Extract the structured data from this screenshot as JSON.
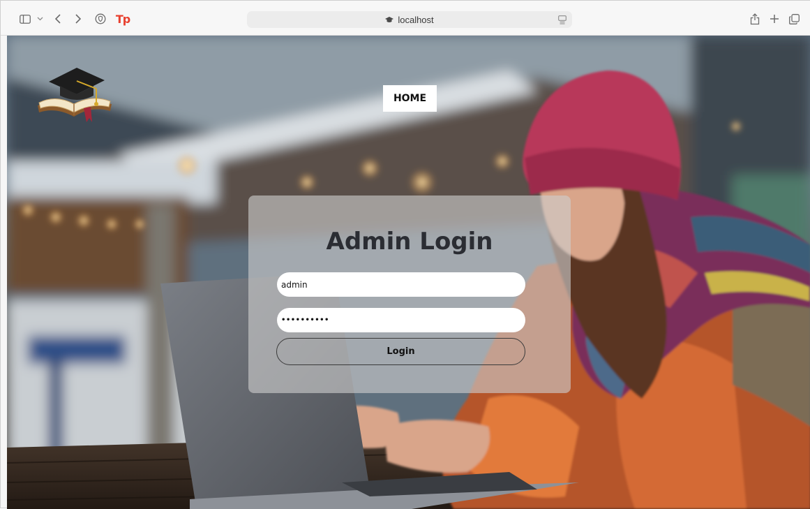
{
  "browser": {
    "url": "localhost",
    "toolbar_icons": [
      "sidebar-icon",
      "chevron-down-icon",
      "back-icon",
      "forward-icon",
      "shield-icon",
      "tp-extension-icon",
      "reader-icon",
      "share-icon",
      "new-tab-icon",
      "tabs-overview-icon"
    ],
    "extension_label": "Tp"
  },
  "page": {
    "nav": {
      "home_label": "HOME"
    },
    "login": {
      "title": "Admin Login",
      "username_value": "admin",
      "password_value": "••••••••••",
      "submit_label": "Login"
    }
  },
  "colors": {
    "card_bg": "rgba(205,205,205,0.62)",
    "title_color": "#2b2d33",
    "extension_accent": "#e8402f"
  }
}
